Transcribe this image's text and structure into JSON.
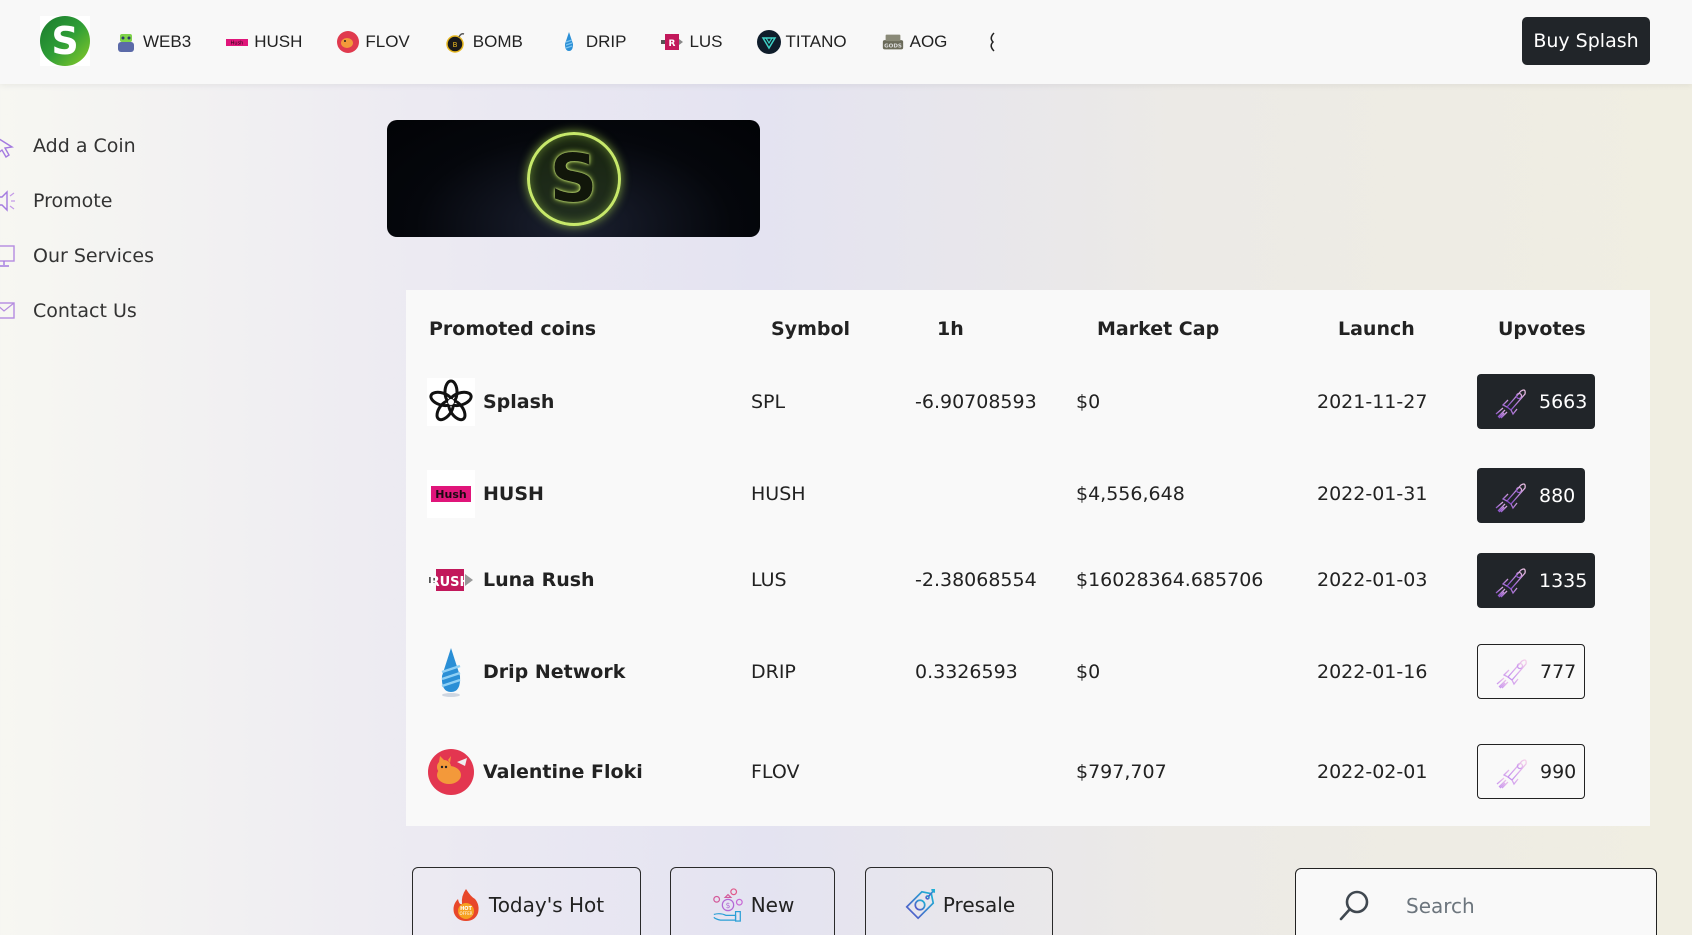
{
  "nav": {
    "brand": "S",
    "ticker": [
      {
        "symbol": "WEB3",
        "icon": "web3-coin-icon"
      },
      {
        "symbol": "HUSH",
        "icon": "hush-coin-icon"
      },
      {
        "symbol": "FLOV",
        "icon": "flov-coin-icon"
      },
      {
        "symbol": "BOMB",
        "icon": "bomb-coin-icon"
      },
      {
        "symbol": "DRIP",
        "icon": "drip-coin-icon"
      },
      {
        "symbol": "LUS",
        "icon": "lus-coin-icon"
      },
      {
        "symbol": "TITANO",
        "icon": "titano-coin-icon"
      },
      {
        "symbol": "AOG",
        "icon": "aog-coin-icon"
      },
      {
        "symbol": "",
        "icon": "partial-coin-icon"
      }
    ],
    "buy_label": "Buy Splash"
  },
  "sidebar": {
    "items": [
      {
        "label": "Add a Coin",
        "icon": "cursor-click-icon"
      },
      {
        "label": "Promote",
        "icon": "megaphone-icon"
      },
      {
        "label": "Our Services",
        "icon": "monitor-icon"
      },
      {
        "label": "Contact Us",
        "icon": "envelope-icon"
      }
    ]
  },
  "banner": {
    "letter": "S"
  },
  "table": {
    "headers": [
      "Promoted coins",
      "Symbol",
      "1h",
      "Market Cap",
      "Launch",
      "Upvotes"
    ],
    "rows": [
      {
        "name": "Splash",
        "symbol": "SPL",
        "change_1h": "-6.90708593",
        "market_cap": "$0",
        "launch": "2021-11-27",
        "upvotes": "5663",
        "voted": true
      },
      {
        "name": "HUSH",
        "symbol": "HUSH",
        "change_1h": "",
        "market_cap": "$4,556,648",
        "launch": "2022-01-31",
        "upvotes": "880",
        "voted": true
      },
      {
        "name": "Luna Rush",
        "symbol": "LUS",
        "change_1h": "-2.38068554",
        "market_cap": "$16028364.685706",
        "launch": "2022-01-03",
        "upvotes": "1335",
        "voted": true
      },
      {
        "name": "Drip Network",
        "symbol": "DRIP",
        "change_1h": "0.3326593",
        "market_cap": "$0",
        "launch": "2022-01-16",
        "upvotes": "777",
        "voted": false
      },
      {
        "name": "Valentine Floki",
        "symbol": "FLOV",
        "change_1h": "",
        "market_cap": "$797,707",
        "launch": "2022-02-01",
        "upvotes": "990",
        "voted": false
      }
    ]
  },
  "filters": {
    "hot": "Today's Hot",
    "new": "New",
    "presale": "Presale"
  },
  "search": {
    "placeholder": "Search",
    "value": ""
  },
  "colors": {
    "dark": "#212529",
    "brand_green": "#2e9d36",
    "accent_purple": "#9b59d6"
  }
}
